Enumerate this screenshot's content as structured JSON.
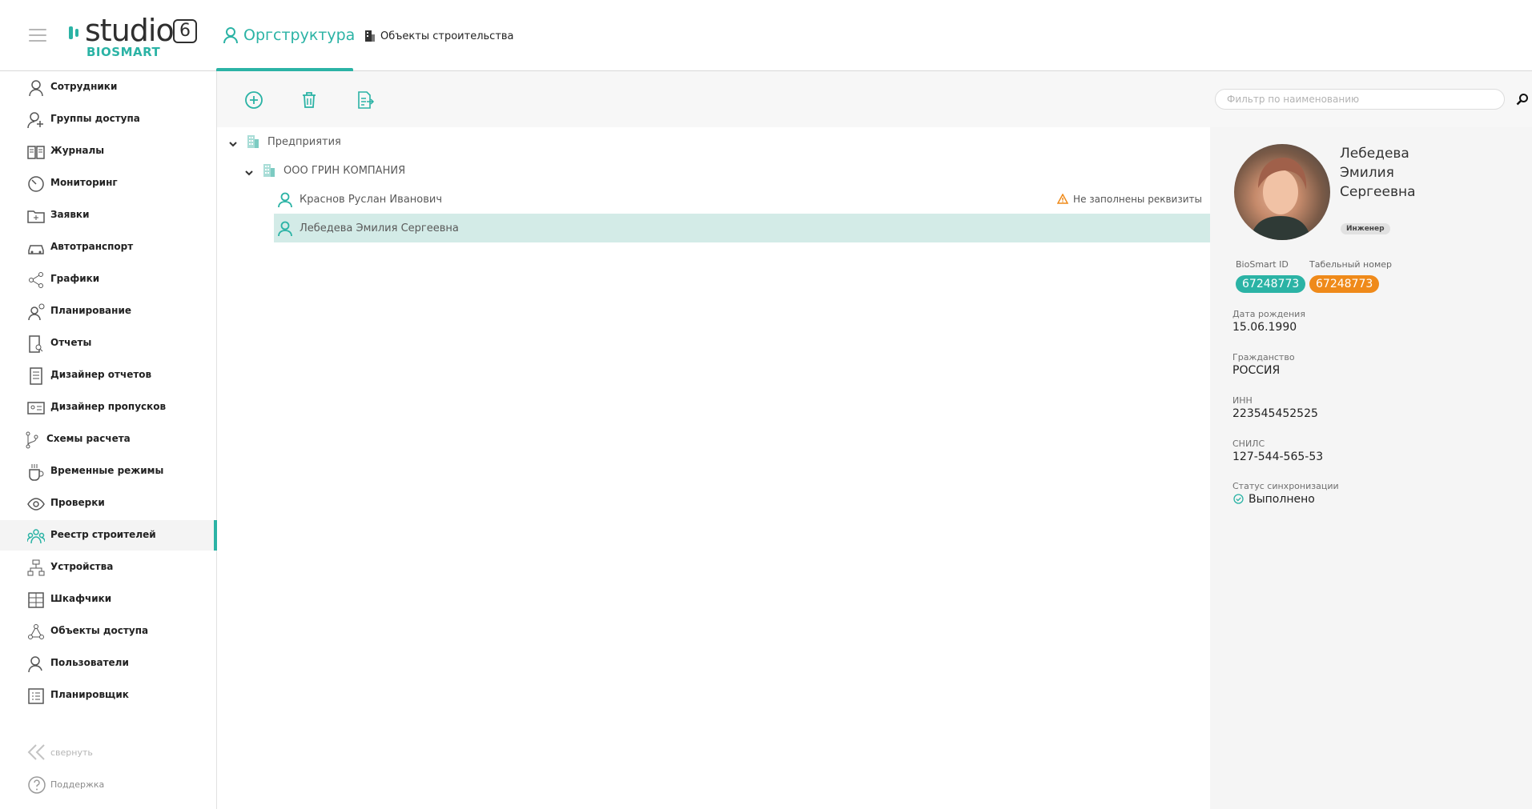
{
  "header": {
    "logo": {
      "text": "studio",
      "version": "6",
      "sub": "BIOSMART"
    },
    "tabs": [
      {
        "label": "Оргструктура",
        "icon": "user-icon",
        "active": true
      },
      {
        "label": "Объекты строительства",
        "icon": "building-icon",
        "active": false
      }
    ]
  },
  "sidebar": {
    "items": [
      {
        "label": "Сотрудники",
        "icon": "user-icon"
      },
      {
        "label": "Группы доступа",
        "icon": "users-plus-icon"
      },
      {
        "label": "Журналы",
        "icon": "book-icon"
      },
      {
        "label": "Мониторинг",
        "icon": "gauge-icon"
      },
      {
        "label": "Заявки",
        "icon": "folder-plus-icon"
      },
      {
        "label": "Автотранспорт",
        "icon": "car-icon"
      },
      {
        "label": "Графики",
        "icon": "share-icon"
      },
      {
        "label": "Планирование",
        "icon": "user-clock-icon"
      },
      {
        "label": "Отчеты",
        "icon": "report-search-icon"
      },
      {
        "label": "Дизайнер отчетов",
        "icon": "report-design-icon"
      },
      {
        "label": "Дизайнер пропусков",
        "icon": "id-card-icon"
      },
      {
        "label": "Схемы расчета",
        "icon": "branch-icon"
      },
      {
        "label": "Временные режимы",
        "icon": "cup-icon"
      },
      {
        "label": "Проверки",
        "icon": "eye-icon"
      },
      {
        "label": "Реестр строителей",
        "icon": "builders-icon",
        "active": true
      },
      {
        "label": "Устройства",
        "icon": "devices-icon"
      },
      {
        "label": "Шкафчики",
        "icon": "lockers-icon"
      },
      {
        "label": "Объекты доступа",
        "icon": "access-objects-icon"
      },
      {
        "label": "Пользователи",
        "icon": "user-add-icon"
      },
      {
        "label": "Планировщик",
        "icon": "list-icon"
      }
    ],
    "collapse_label": "свернуть",
    "support_label": "Поддержка"
  },
  "toolbar": {
    "add_icon": "plus-circle-icon",
    "delete_icon": "trash-icon",
    "export_icon": "file-export-icon",
    "filter_placeholder": "Фильтр по наименованию"
  },
  "tree": {
    "root": "Предприятия",
    "company": "ООО ГРИН КОМПАНИЯ",
    "employees": [
      {
        "name": "Краснов  Руслан  Иванович",
        "warning": "Не заполнены реквизиты",
        "selected": false
      },
      {
        "name": "Лебедева  Эмилия  Сергеевна",
        "warning": "",
        "selected": true
      }
    ]
  },
  "card": {
    "last_name": "Лебедева",
    "first_name": "Эмилия",
    "patronymic": "Сергеевна",
    "role": "Инженер",
    "biosmart_id_label": "BioSmart ID",
    "biosmart_id": "67248773",
    "tab_number_label": "Табельный номер",
    "tab_number": "67248773",
    "birth_label": "Дата рождения",
    "birth": "15.06.1990",
    "citizenship_label": "Гражданство",
    "citizenship": "РОССИЯ",
    "inn_label": "ИНН",
    "inn": "223545452525",
    "snils_label": "СНИЛС",
    "snils": "127-544-565-53",
    "sync_label": "Статус синхронизации",
    "sync": "Выполнено"
  },
  "colors": {
    "accent": "#2bb3a5",
    "orange": "#ef8a1a",
    "selected_row": "#d3ebe7"
  }
}
